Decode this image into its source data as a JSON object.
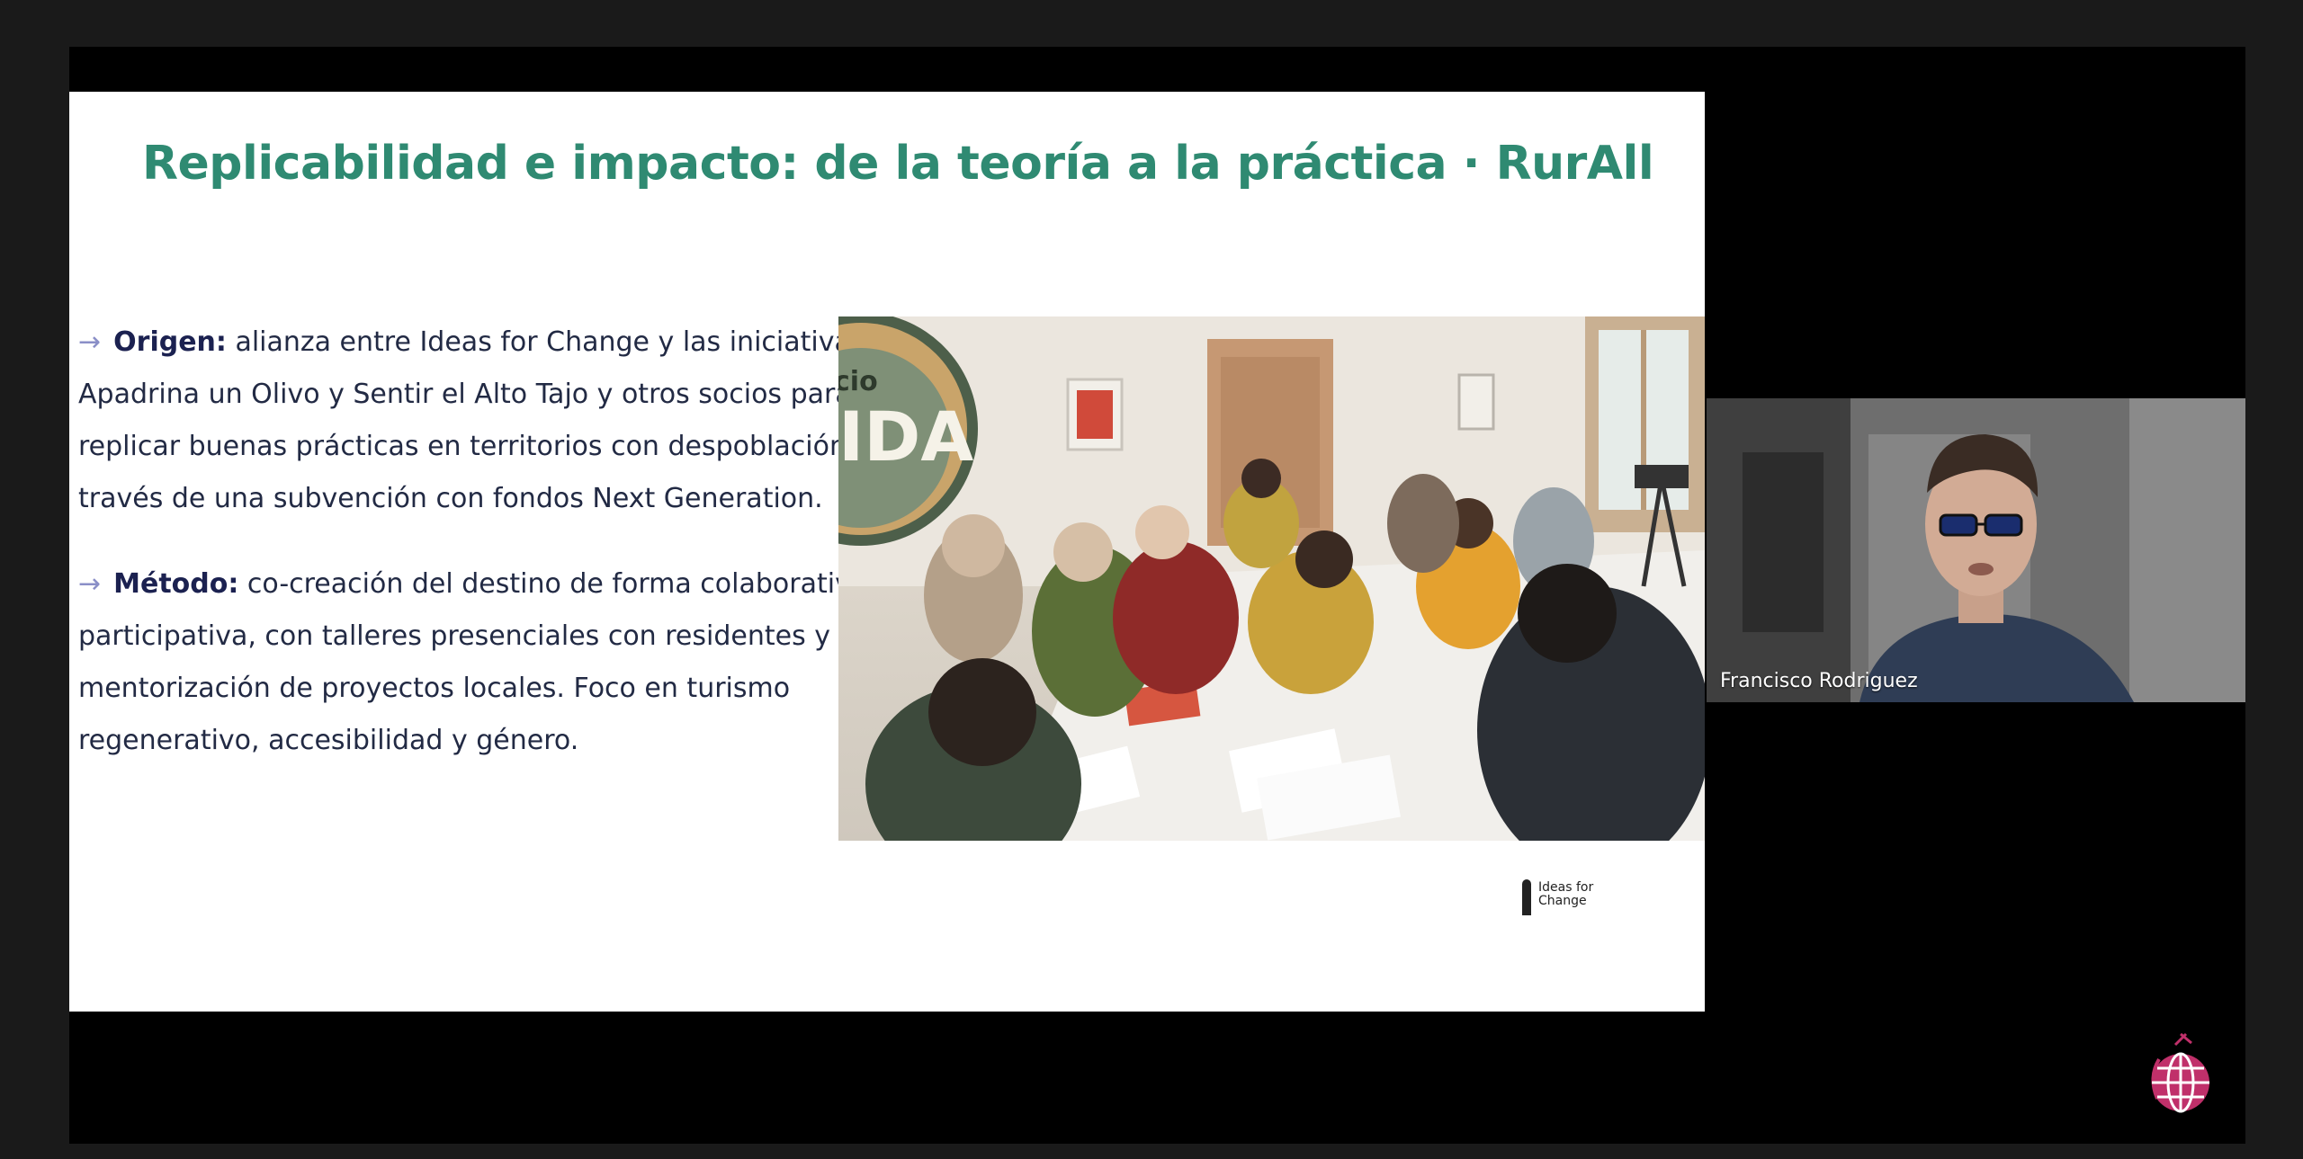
{
  "slide": {
    "title": "Replicabilidad e impacto: de la teoría a la práctica · RurAll",
    "bullets": [
      {
        "arrow": "→",
        "lead": "Origen:",
        "text": " alianza entre Ideas for Change y las iniciativas Apadrina un Olivo y Sentir el Alto Tajo y otros socios para replicar buenas prácticas en territorios con despoblación a través de una subvención con fondos Next Generation."
      },
      {
        "arrow": "→",
        "lead": "Método:",
        "text": " co-creación del destino de forma colaborativa y participativa, con talleres presenciales con residentes y mentorización de proyectos locales. Foco en turismo regenerativo, accesibilidad y género."
      }
    ],
    "photo_sign": "cio\nIDA",
    "logo": "Ideas for\nChange"
  },
  "participant": {
    "name": "Francisco Rodriguez"
  },
  "colors": {
    "title": "#2f8a72",
    "body_text": "#222a44",
    "arrow": "#8a8fc7",
    "app_background": "#1a1a1a",
    "globe_accent": "#c0306a"
  },
  "icons": [
    "arrow-right-icon",
    "camera-feed",
    "globe-icon"
  ]
}
